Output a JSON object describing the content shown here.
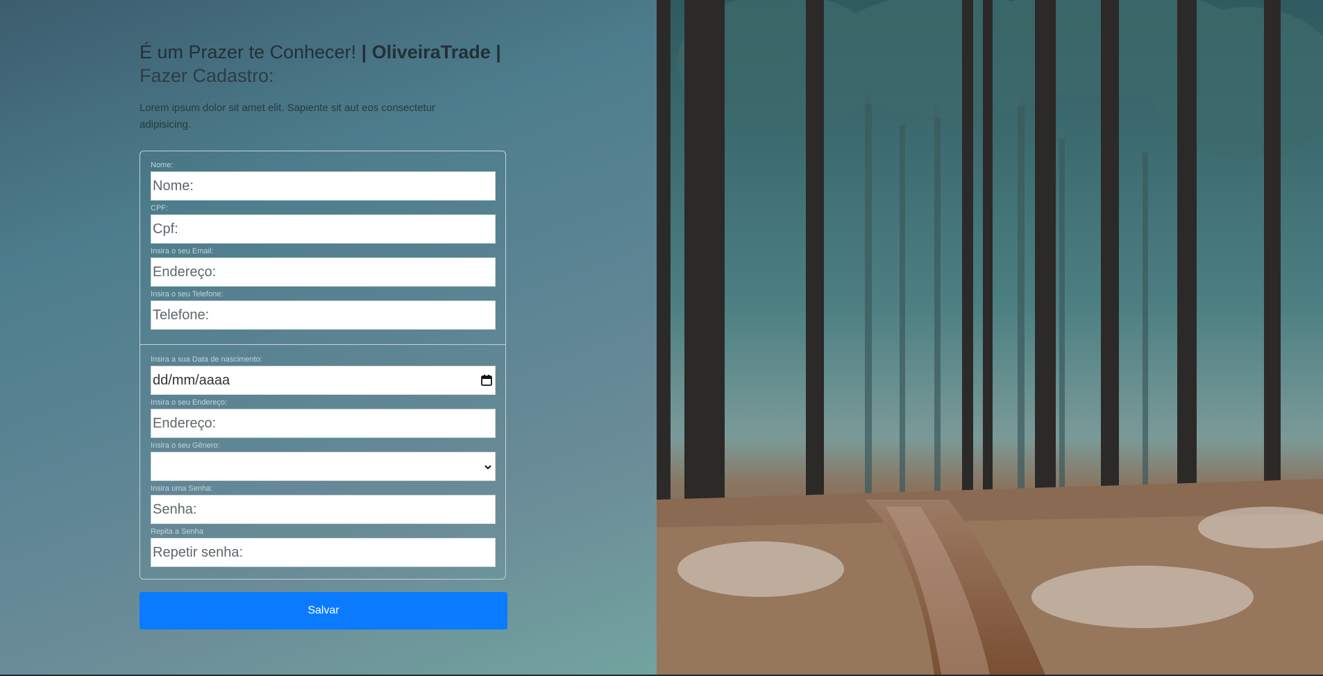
{
  "header": {
    "title_prefix": "É um Prazer te Conhecer!",
    "title_brand": "| OliveiraTrade |",
    "title_sub": "Fazer Cadastro:",
    "lead": "Lorem ipsum dolor sit amet elit. Sapiente sit aut eos consectetur adipisicing."
  },
  "form": {
    "fields": [
      {
        "label": "Nome:",
        "placeholder": "Nome:"
      },
      {
        "label": "CPF:",
        "placeholder": "Cpf:"
      },
      {
        "label": "Insira o seu Email:",
        "placeholder": "Endereço:"
      },
      {
        "label": "Insira o seu Telefone:",
        "placeholder": "Telefone:"
      },
      {
        "label": "Insira a sua Data de nascimento:",
        "placeholder": "dd/mm/aaaa"
      },
      {
        "label": "Insira o seu Endereço:",
        "placeholder": "Endereço:"
      },
      {
        "label": "Insira o seu Gênero:",
        "placeholder": ""
      },
      {
        "label": "Insira uma Senha:",
        "placeholder": "Senha:"
      },
      {
        "label": "Repita a Senha",
        "placeholder": "Repetir senha:"
      }
    ],
    "submit_label": "Salvar"
  },
  "icons": {
    "date": "calendar-icon",
    "select": "chevron-down-icon"
  },
  "colors": {
    "accent": "#0a7bff"
  }
}
